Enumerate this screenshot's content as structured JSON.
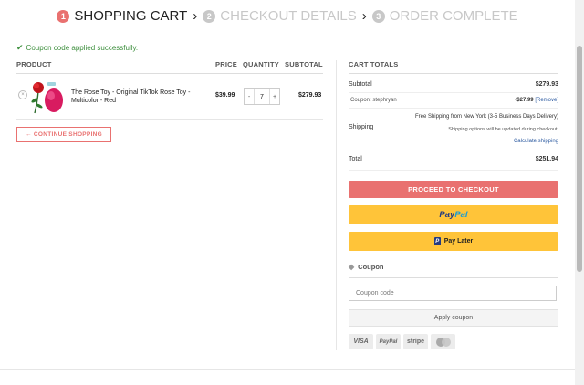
{
  "steps": [
    {
      "num": "1",
      "label": "SHOPPING CART"
    },
    {
      "num": "2",
      "label": "CHECKOUT DETAILS"
    },
    {
      "num": "3",
      "label": "ORDER COMPLETE"
    }
  ],
  "notice": "Coupon code applied successfully.",
  "cart": {
    "headers": {
      "product": "PRODUCT",
      "price": "PRICE",
      "quantity": "QUANTITY",
      "subtotal": "SUBTOTAL"
    },
    "item": {
      "remove": "×",
      "name": "The Rose Toy - Original TikTok Rose Toy - Multicolor - Red",
      "price": "$39.99",
      "qty": "7",
      "minus": "-",
      "plus": "+",
      "subtotal": "$279.93"
    },
    "continue_label": "← CONTINUE SHOPPING"
  },
  "totals": {
    "title": "CART TOTALS",
    "subtotal_label": "Subtotal",
    "subtotal_value": "$279.93",
    "coupon_label": "Coupon: stephryan",
    "coupon_amount": "-$27.99",
    "coupon_remove": "[Remove]",
    "shipping_label": "Shipping",
    "shipping_option": "Free Shipping from New York (3-5 Business Days Delivery)",
    "shipping_note": "Shipping options will be updated during checkout.",
    "shipping_calc": "Calculate shipping",
    "total_label": "Total",
    "total_value": "$251.94"
  },
  "buttons": {
    "checkout": "PROCEED TO CHECKOUT",
    "paypal_a": "Pay",
    "paypal_b": "Pal",
    "paylater_icon": "P",
    "paylater": "Pay Later"
  },
  "coupon": {
    "heading": "Coupon",
    "placeholder": "Coupon code",
    "apply": "Apply coupon"
  },
  "payment_icons": {
    "visa": "VISA",
    "paypal": "PayPal",
    "stripe": "stripe"
  }
}
